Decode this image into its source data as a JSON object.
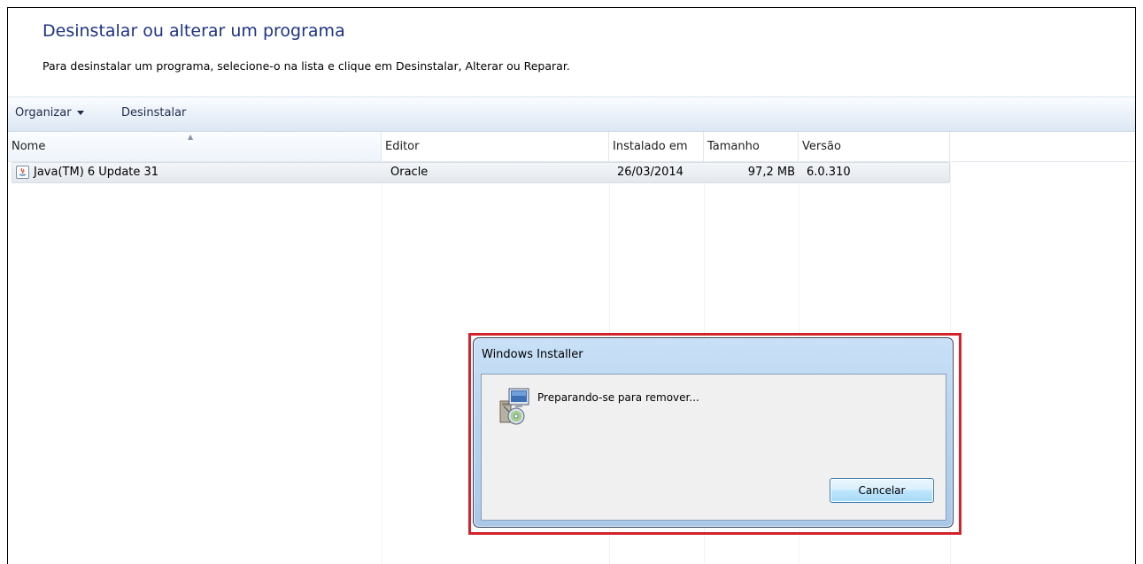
{
  "header": {
    "title": "Desinstalar ou alterar um programa",
    "description": "Para desinstalar um programa, selecione-o na lista e clique em Desinstalar, Alterar ou Reparar."
  },
  "toolbar": {
    "organize_label": "Organizar",
    "uninstall_label": "Desinstalar"
  },
  "columns": {
    "name": "Nome",
    "editor": "Editor",
    "installed": "Instalado em",
    "size": "Tamanho",
    "version": "Versão"
  },
  "programs": [
    {
      "name": "Java(TM) 6 Update 31",
      "editor": "Oracle",
      "installed": "26/03/2014",
      "size": "97,2 MB",
      "version": "6.0.310",
      "icon": "java-icon"
    }
  ],
  "dialog": {
    "title": "Windows Installer",
    "message": "Preparando-se para remover...",
    "cancel_label": "Cancelar",
    "icon": "installer-icon"
  },
  "colors": {
    "highlight": "#d2232a",
    "title_blue": "#1e3287"
  }
}
